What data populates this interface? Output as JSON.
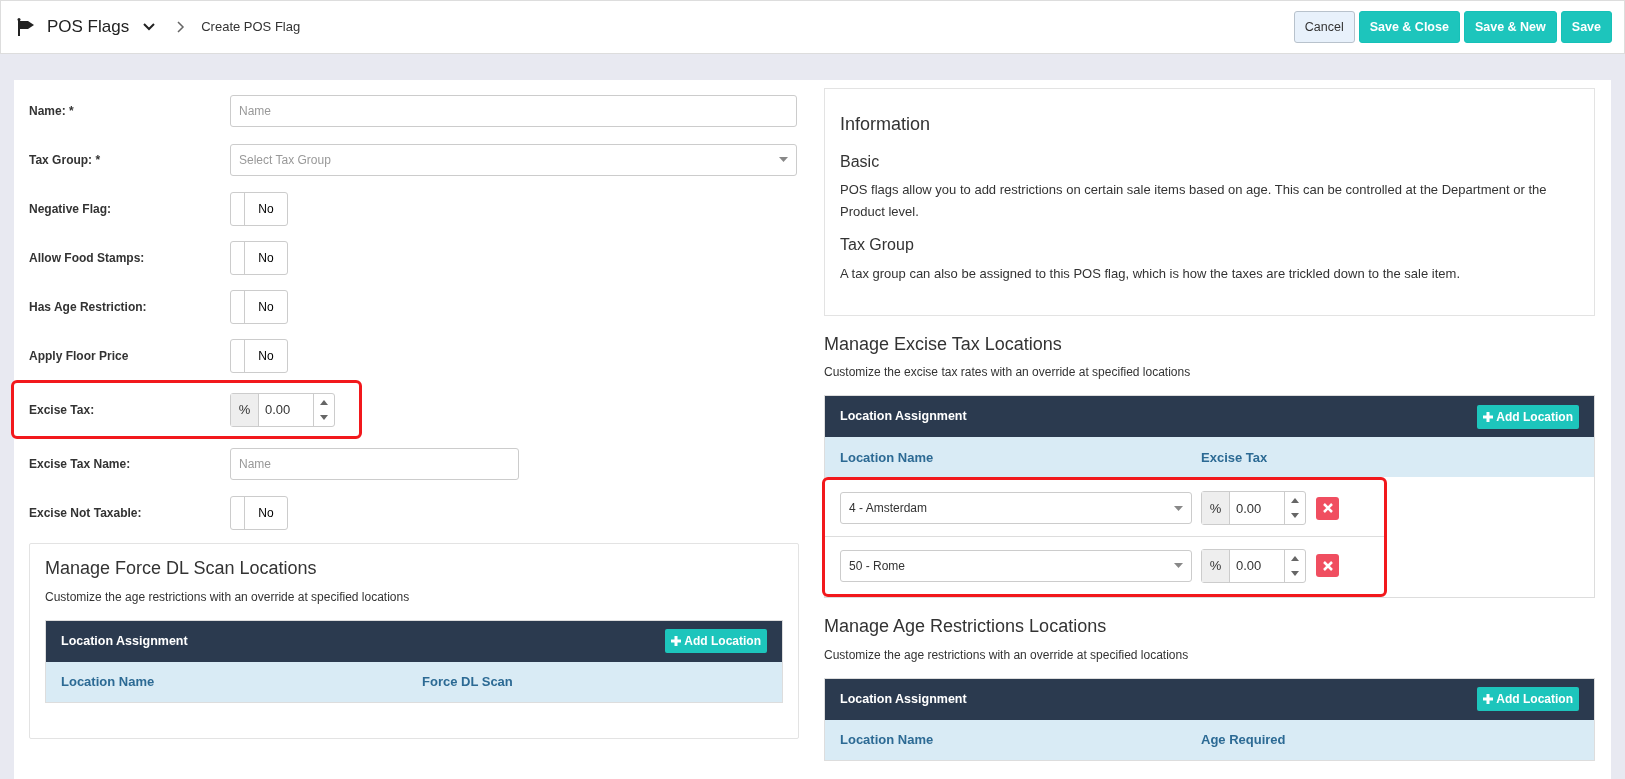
{
  "header": {
    "title": "POS Flags",
    "breadcrumb": "Create POS Flag",
    "buttons": [
      {
        "label": "Cancel",
        "kind": "secondary"
      },
      {
        "label": "Save & Close",
        "kind": "primary"
      },
      {
        "label": "Save & New",
        "kind": "primary"
      },
      {
        "label": "Save",
        "kind": "primary"
      }
    ]
  },
  "form": {
    "fields": [
      {
        "kind": "text",
        "label": "Name: *",
        "placeholder": "Name"
      },
      {
        "kind": "select",
        "label": "Tax Group: *",
        "placeholder": "Select Tax Group"
      },
      {
        "kind": "toggle",
        "label": "Negative Flag:",
        "on": false,
        "text": "No"
      },
      {
        "kind": "toggle",
        "label": "Allow Food Stamps:",
        "on": false,
        "text": "No"
      },
      {
        "kind": "toggle",
        "label": "Has Age Restriction:",
        "on": false,
        "text": "No"
      },
      {
        "kind": "toggle",
        "label": "Apply Floor Price",
        "on": false,
        "text": "No"
      },
      {
        "kind": "number",
        "label": "Excise Tax:",
        "addon": "%",
        "value": "0.00",
        "highlighted": true
      },
      {
        "kind": "short_text",
        "label": "Excise Tax Name:",
        "placeholder": "Name"
      },
      {
        "kind": "toggle",
        "label": "Excise Not Taxable:",
        "on": false,
        "text": "No"
      }
    ]
  },
  "force_dl": {
    "title": "Manage Force DL Scan Locations",
    "subtitle": "Customize the age restrictions with an override at specified locations",
    "table": {
      "header": "Location Assignment",
      "add_button": "Add Location",
      "columns": [
        "Location Name",
        "Force DL Scan"
      ]
    }
  },
  "info": {
    "title": "Information",
    "sections": [
      {
        "heading": "Basic",
        "text": "POS flags allow you to add restrictions on certain sale items based on age. This can be controlled at the Department or the Product level."
      },
      {
        "heading": "Tax Group",
        "text": "A tax group can also be assigned to this POS flag, which is how the taxes are trickled down to the sale item."
      }
    ]
  },
  "excise_locations": {
    "title": "Manage Excise Tax Locations",
    "subtitle": "Customize the excise tax rates with an override at specified locations",
    "table": {
      "header": "Location Assignment",
      "add_button": "Add Location",
      "columns": [
        "Location Name",
        "Excise Tax"
      ],
      "rows_highlighted": true,
      "rows": [
        {
          "location": "4 - Amsterdam",
          "addon": "%",
          "value": "0.00"
        },
        {
          "location": "50 - Rome",
          "addon": "%",
          "value": "0.00"
        }
      ]
    }
  },
  "age_locations": {
    "title": "Manage Age Restrictions Locations",
    "subtitle": "Customize the age restrictions with an override at specified locations",
    "table": {
      "header": "Location Assignment",
      "add_button": "Add Location",
      "columns": [
        "Location Name",
        "Age Required"
      ]
    }
  }
}
